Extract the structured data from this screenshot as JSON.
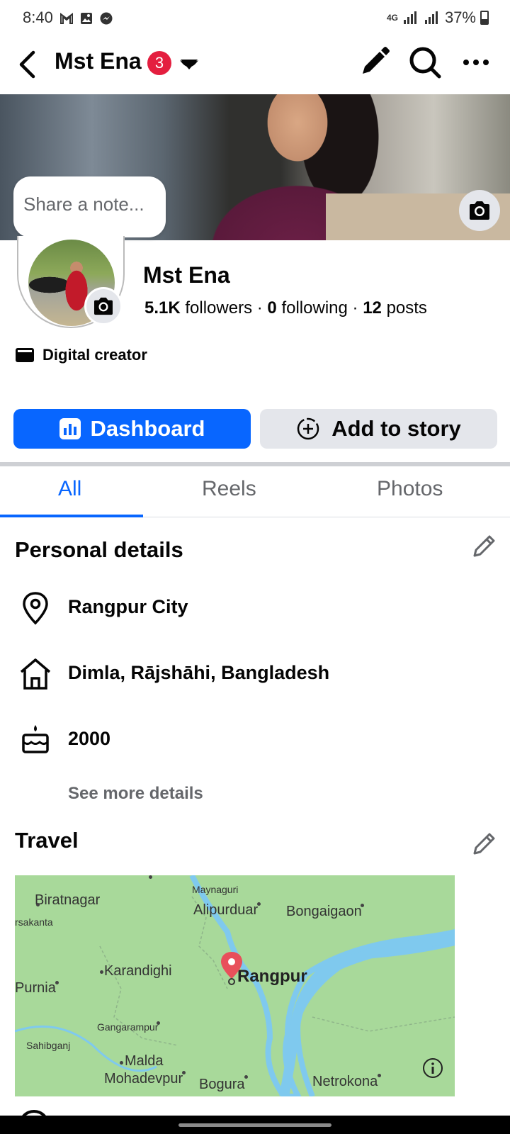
{
  "status_bar": {
    "time": "8:40",
    "network": "4G",
    "battery": "37%"
  },
  "header": {
    "title": "Mst Ena",
    "badge_count": "3",
    "icons": [
      "back-arrow-icon",
      "chevron-down-icon",
      "pencil-icon",
      "search-icon",
      "more-icon"
    ]
  },
  "cover": {
    "note_placeholder": "Share a note..."
  },
  "profile": {
    "name": "Mst Ena",
    "followers_count": "5.1K",
    "followers_label": "followers",
    "following_count": "0",
    "following_label": "following",
    "posts_count": "12",
    "posts_label": "posts",
    "category": "Digital creator"
  },
  "actions": {
    "dashboard_label": "Dashboard",
    "add_story_label": "Add to story"
  },
  "tabs": [
    {
      "label": "All",
      "active": true
    },
    {
      "label": "Reels",
      "active": false
    },
    {
      "label": "Photos",
      "active": false
    }
  ],
  "personal_details": {
    "title": "Personal details",
    "items": [
      {
        "icon": "location-pin-icon",
        "text": "Rangpur City"
      },
      {
        "icon": "home-icon",
        "text": "Dimla, Rājshāhi, Bangladesh"
      },
      {
        "icon": "cake-icon",
        "text": "2000"
      }
    ],
    "see_more": "See more details"
  },
  "travel": {
    "title": "Travel",
    "map_places": [
      "Biratnagar",
      "rsakanta",
      "Maynaguri",
      "Alipurduar",
      "Bongaigaon",
      "Karandighi",
      "Rangpur",
      "Purnia",
      "Gangarampur",
      "Sahibganj",
      "Malda",
      "Mohadevpur",
      "Bogura",
      "Netrokona"
    ],
    "marker_place": "Rangpur"
  },
  "colors": {
    "accent": "#0866ff",
    "badge": "#e41e3f",
    "map_land": "#a8d99a",
    "map_water": "#7fc9ee",
    "marker": "#e8505b"
  }
}
